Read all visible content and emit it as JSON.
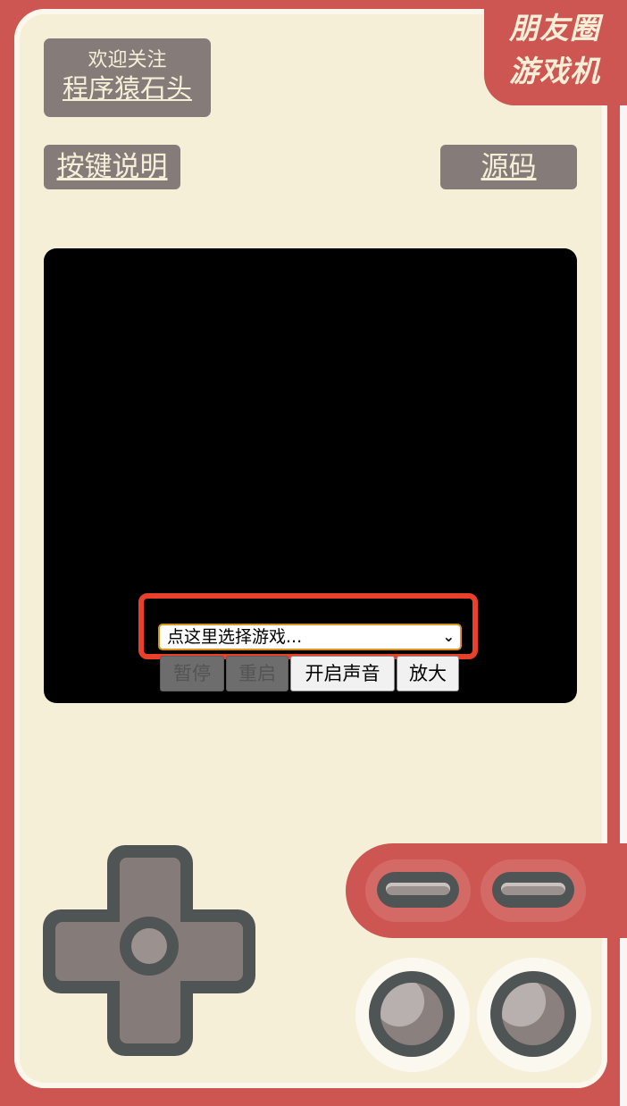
{
  "brand": {
    "line1": "朋友圈",
    "line2": "游戏机"
  },
  "follow": {
    "line1": "欢迎关注",
    "line2": "程序猿石头"
  },
  "buttons": {
    "help": "按键说明",
    "source": "源码"
  },
  "game_select": {
    "placeholder": "点这里选择游戏..."
  },
  "controls": {
    "pause": "暂停",
    "restart": "重启",
    "sound": "开启声音",
    "zoom": "放大"
  },
  "colors": {
    "shell": "#cd5552",
    "panel": "#f6efd8",
    "button": "#857b78",
    "highlight": "#e8402a"
  }
}
